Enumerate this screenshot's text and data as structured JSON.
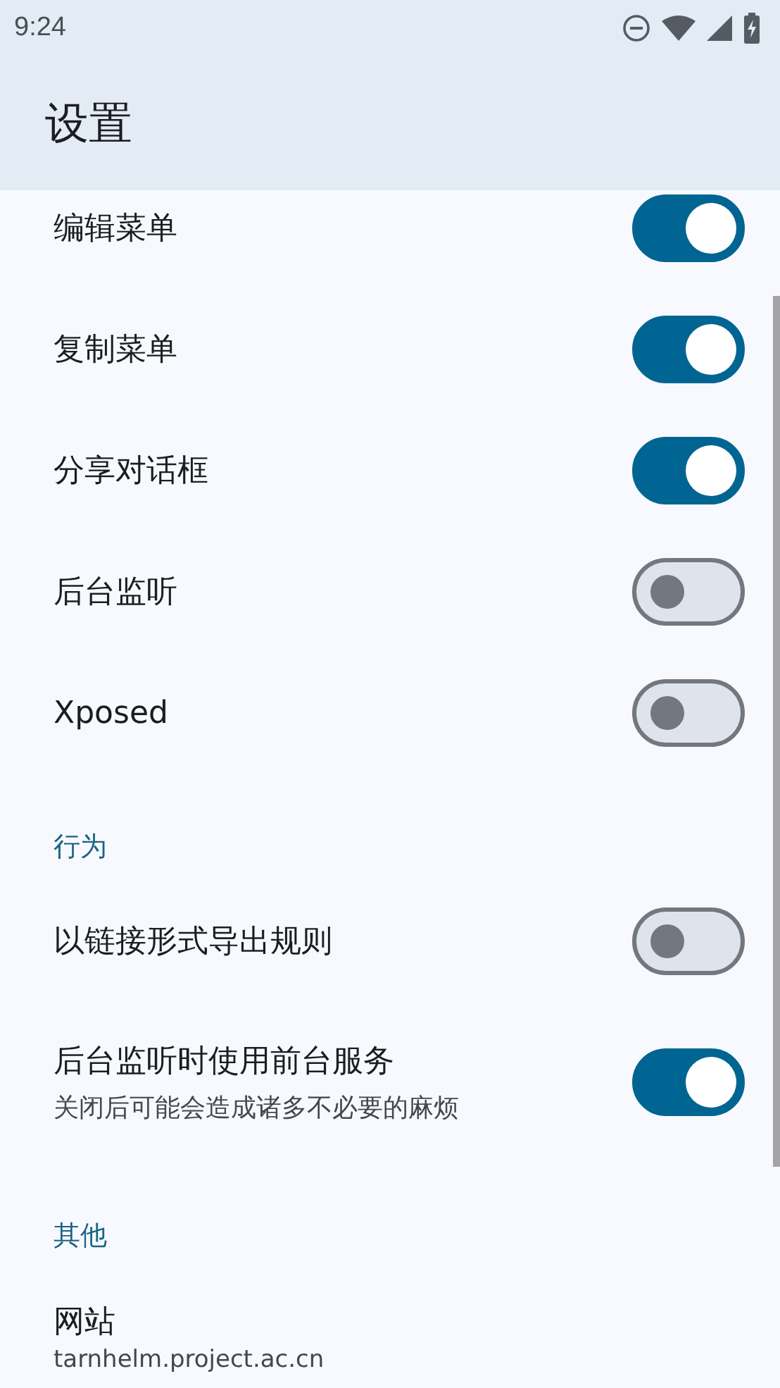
{
  "status_bar": {
    "time": "9:24"
  },
  "app_bar": {
    "title": "设置"
  },
  "sections": [
    {
      "items": [
        {
          "kind": "switch",
          "title": "编辑菜单",
          "on": true
        },
        {
          "kind": "switch",
          "title": "复制菜单",
          "on": true
        },
        {
          "kind": "switch",
          "title": "分享对话框",
          "on": true
        },
        {
          "kind": "switch",
          "title": "后台监听",
          "on": false
        },
        {
          "kind": "switch",
          "title": "Xposed",
          "on": false
        }
      ]
    },
    {
      "header": "行为",
      "items": [
        {
          "kind": "switch",
          "title": "以链接形式导出规则",
          "on": false
        },
        {
          "kind": "switch",
          "title": "后台监听时使用前台服务",
          "subtitle": "关闭后可能会造成诸多不必要的麻烦",
          "on": true
        }
      ]
    },
    {
      "header": "其他",
      "items": [
        {
          "kind": "link",
          "title": "网站",
          "subtitle": "tarnhelm.project.ac.cn"
        }
      ]
    }
  ]
}
